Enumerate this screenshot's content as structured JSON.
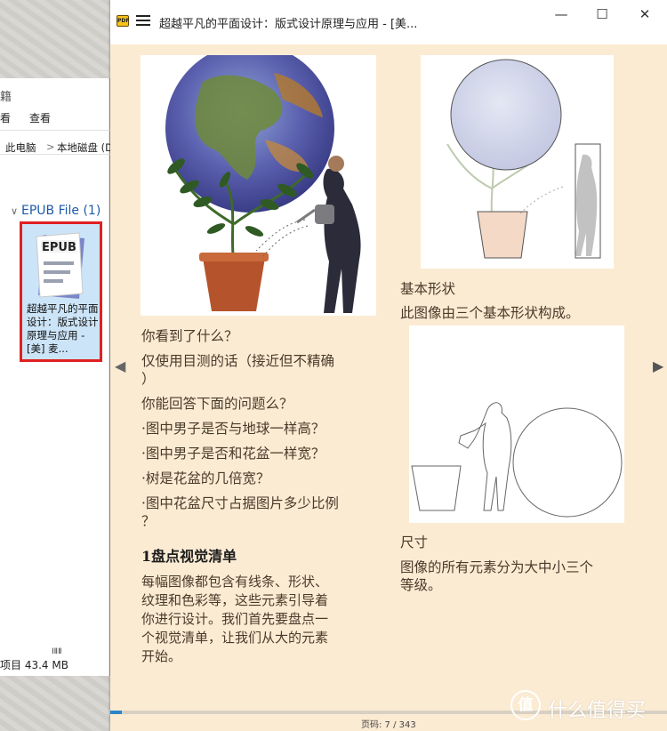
{
  "explorer": {
    "title_fragment": "籍",
    "menu": [
      "看",
      "查看"
    ],
    "path": [
      "此电脑",
      "本地磁盘 (D"
    ],
    "path_separator": ">",
    "group_header": "EPUB File (1)",
    "file": {
      "icon_label": "EPUB",
      "name": "超越平凡的平面设计：版式设计原理与应用 - [美] 麦..."
    },
    "small_text": "ⅠⅡⅡ",
    "status": "项目 43.4 MB"
  },
  "reader": {
    "app_logo_text": "PDF",
    "window_title": "超越平凡的平面设计：版式设计原理与应用 - [美...",
    "controls": {
      "minimize": "—",
      "maximize": "☐",
      "close": "✕"
    },
    "nav": {
      "prev": "◀",
      "next": "▶"
    },
    "left_column": {
      "questions": [
        "你看到了什么？",
        "仅使用目测的话（接近但不精确",
        "）",
        "你能回答下面的问题么？",
        "·图中男子是否与地球一样高？",
        "·图中男子是否和花盆一样宽？",
        "·树是花盆的几倍宽？",
        "·图中花盆尺寸占据图片多少比例",
        "？"
      ],
      "heading": "1盘点视觉清单",
      "body_lines": [
        "每幅图像都包含有线条、形状、",
        "纹理和色彩等，这些元素引导着",
        "你进行设计。我们首先要盘点一",
        "个视觉清单，让我们从大的元素",
        "开始。"
      ]
    },
    "right_column": {
      "shapes_caption": "基本形状",
      "shapes_desc": "此图像由三个基本形状构成。",
      "sizes_caption": "尺寸",
      "sizes_desc": [
        "图像的所有元素分为大中小三个",
        "等级。"
      ]
    },
    "page_indicator": "页码: 7 / 343",
    "progress": {
      "current": 7,
      "total": 343
    }
  },
  "watermark": {
    "badge": "值",
    "text": "什么值得买"
  },
  "colors": {
    "reader_bg": "#fbebd3",
    "text": "#4a3a2a",
    "accent": "#2a85c9",
    "selection_border": "#e02020",
    "link": "#1e5aa8"
  }
}
